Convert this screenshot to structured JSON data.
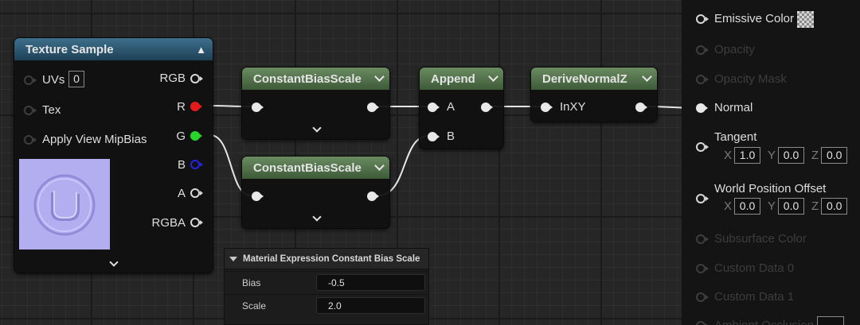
{
  "texture_sample": {
    "title": "Texture Sample",
    "inputs": [
      {
        "label": "UVs",
        "value": "0"
      },
      {
        "label": "Tex"
      },
      {
        "label": "Apply View MipBias"
      }
    ],
    "outputs": [
      "RGB",
      "R",
      "G",
      "B",
      "A",
      "RGBA"
    ]
  },
  "bias_scale_nodes": [
    {
      "title": "ConstantBiasScale"
    },
    {
      "title": "ConstantBiasScale"
    }
  ],
  "append_node": {
    "title": "Append",
    "inputs": [
      "A",
      "B"
    ]
  },
  "derive_node": {
    "title": "DeriveNormalZ",
    "inputs": [
      "InXY"
    ]
  },
  "details": {
    "section_title": "Material Expression Constant Bias Scale",
    "properties": [
      {
        "name": "Bias",
        "value": "-0.5"
      },
      {
        "name": "Scale",
        "value": "2.0"
      }
    ]
  },
  "material_result": {
    "pins": [
      {
        "label": "Emissive Color",
        "active": true
      },
      {
        "label": "Opacity",
        "active": false
      },
      {
        "label": "Opacity Mask",
        "active": false
      },
      {
        "label": "Normal",
        "active": true
      },
      {
        "label": "Tangent",
        "active": true,
        "vector": {
          "x": "1.0",
          "y": "0.0",
          "z": "0.0"
        }
      },
      {
        "label": "World Position Offset",
        "active": true,
        "vector": {
          "x": "0.0",
          "y": "0.0",
          "z": "0.0"
        }
      },
      {
        "label": "Subsurface Color",
        "active": false
      },
      {
        "label": "Custom Data 0",
        "active": false
      },
      {
        "label": "Custom Data 1",
        "active": false
      },
      {
        "label": "Ambient Occlusion",
        "active": false
      }
    ],
    "axis_labels": {
      "x": "X",
      "y": "Y",
      "z": "Z"
    }
  },
  "colors": {
    "texture_header": "#2e5a75",
    "expression_header": "#5a7a52",
    "pin_r": "#e51a1a",
    "pin_g": "#27d52b",
    "pin_b": "#2424e0",
    "wire": "#e8e8e8"
  }
}
